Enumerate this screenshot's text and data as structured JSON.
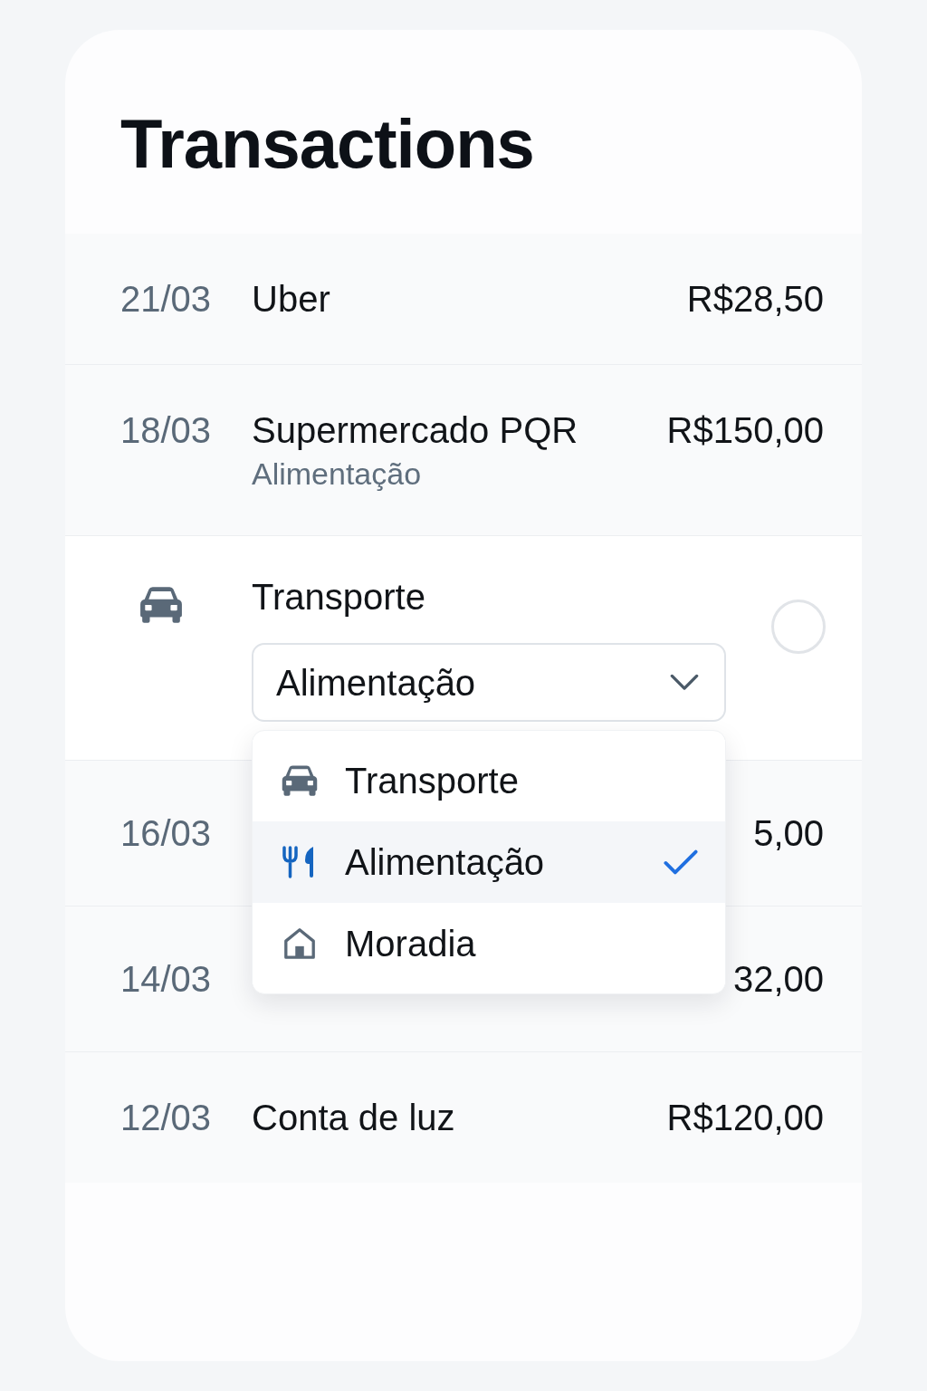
{
  "title": "Transactions",
  "transactions": [
    {
      "kind": "transaction",
      "date": "21/03",
      "name": "Uber",
      "amount": "R$28,50"
    },
    {
      "kind": "transaction",
      "date": "18/03",
      "name": "Supermercado PQR",
      "category": "Alimentação",
      "amount": "R$150,00"
    },
    {
      "kind": "editing",
      "name": "Transporte",
      "checked": false,
      "category_select": {
        "value": "Alimentação",
        "expanded": true,
        "options": [
          {
            "label": "Transporte",
            "selected": false
          },
          {
            "label": "Alimentação",
            "selected": true
          },
          {
            "label": "Moradia",
            "selected": false
          }
        ]
      }
    },
    {
      "kind": "transaction",
      "date": "16/03",
      "amount": "5,00"
    },
    {
      "kind": "transaction",
      "date": "14/03",
      "amount": "32,00"
    },
    {
      "kind": "transaction",
      "date": "12/03",
      "name": "Conta de luz",
      "amount": "R$120,00"
    }
  ]
}
